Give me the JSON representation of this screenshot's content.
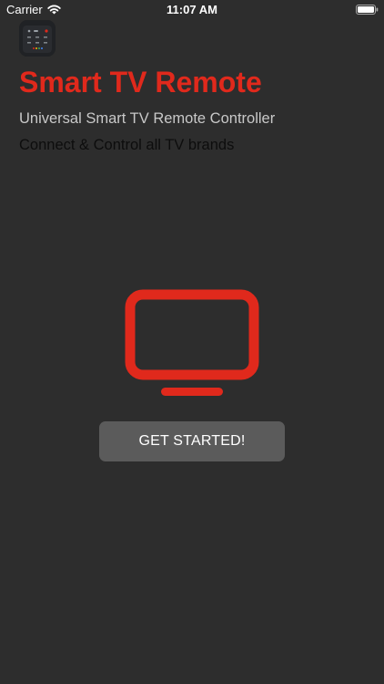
{
  "status_bar": {
    "carrier": "Carrier",
    "time": "11:07 AM",
    "icons": [
      "wifi-icon",
      "battery-icon"
    ]
  },
  "app": {
    "icon": "remote-app-icon",
    "title": "Smart TV Remote",
    "subtitle": "Universal Smart TV Remote Controller",
    "tagline": "Connect & Control all TV brands"
  },
  "hero": {
    "icon": "tv-icon"
  },
  "actions": {
    "get_started_label": "GET STARTED!"
  },
  "colors": {
    "background": "#2d2d2d",
    "accent": "#e0291c",
    "button": "#5b5b5b",
    "subtitle": "#c8c8c8",
    "tagline": "#0d0d0d"
  }
}
